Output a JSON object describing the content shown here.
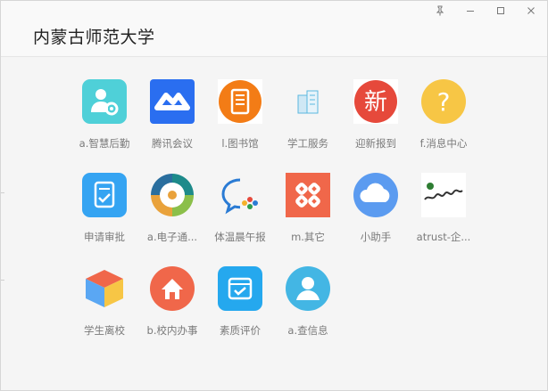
{
  "window": {
    "title": "内蒙古师范大学"
  },
  "controls": {
    "pin": "pin-icon",
    "minimize": "minimize-icon",
    "maximize": "maximize-icon",
    "close": "close-icon"
  },
  "apps": [
    {
      "label": "a.智慧后勤",
      "icon": "smart-logistics-icon",
      "color": "#4fd0d8"
    },
    {
      "label": "腾讯会议",
      "icon": "tencent-meeting-icon",
      "color": "#2a6ef0"
    },
    {
      "label": "l.图书馆",
      "icon": "library-icon",
      "color": "#f37c16"
    },
    {
      "label": "学工服务",
      "icon": "student-affairs-icon",
      "color": "#5bb8e0"
    },
    {
      "label": "迎新报到",
      "icon": "freshman-registration-icon",
      "color": "#e6493b",
      "glyph": "新"
    },
    {
      "label": "f.消息中心",
      "icon": "message-center-icon",
      "color": "#f7c645",
      "glyph": "?"
    },
    {
      "label": "申请审批",
      "icon": "approval-icon",
      "color": "#35a4f2"
    },
    {
      "label": "a.电子通...",
      "icon": "e-pass-icon",
      "color": "#e9a23b"
    },
    {
      "label": "体温晨午报",
      "icon": "temperature-report-icon",
      "color": "#2a7bd4"
    },
    {
      "label": "m.其它",
      "icon": "others-icon",
      "color": "#f0674a"
    },
    {
      "label": "小助手",
      "icon": "assistant-icon",
      "color": "#5b9bf0"
    },
    {
      "label": "atrust-企...",
      "icon": "atrust-icon",
      "color": "#2e7d32"
    },
    {
      "label": "学生离校",
      "icon": "student-leave-icon",
      "color": "#5aa7f3"
    },
    {
      "label": "b.校内办事",
      "icon": "campus-affairs-icon",
      "color": "#f0674a"
    },
    {
      "label": "素质评价",
      "icon": "quality-evaluation-icon",
      "color": "#25a8ee"
    },
    {
      "label": "a.查信息",
      "icon": "query-info-icon",
      "color": "#43b6e4"
    }
  ]
}
